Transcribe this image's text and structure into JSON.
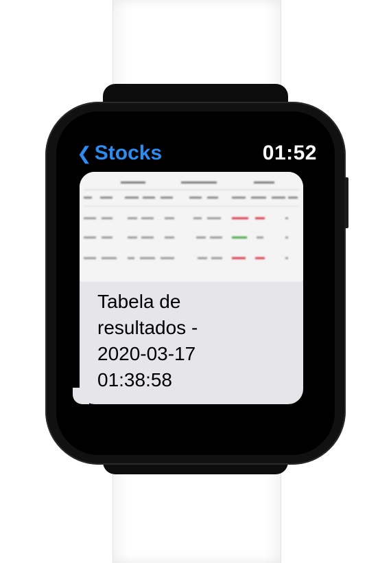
{
  "header": {
    "back_label": "Stocks",
    "back_icon": "chevron-left-icon",
    "time": "01:52",
    "accent_color": "#2d8cf0"
  },
  "message": {
    "attachment": {
      "kind": "table-image",
      "row_count": 4,
      "status_colors": [
        "#d9404f",
        "#49a845"
      ]
    },
    "caption_lines": [
      "Tabela de",
      "resultados -",
      "2020-03-17",
      "01:38:58"
    ]
  }
}
